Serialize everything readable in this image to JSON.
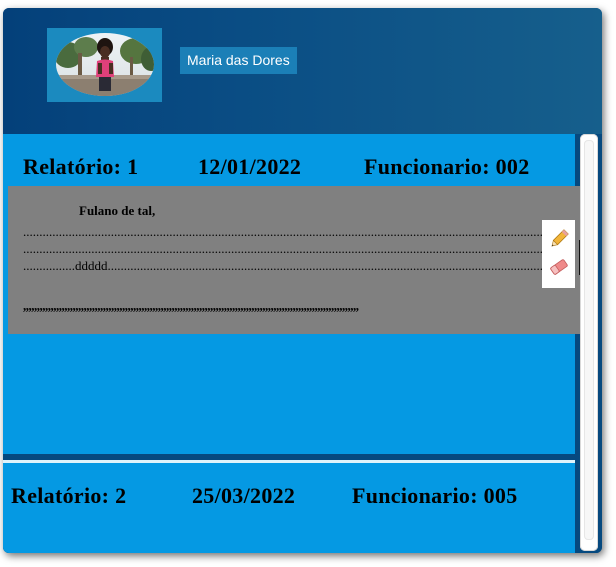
{
  "header": {
    "user_name": "Maria das Dores",
    "avatar_icon": "user-photo"
  },
  "reports": [
    {
      "title": "Relatório: 1",
      "date": "12/01/2022",
      "employee": "Funcionario: 002",
      "greeting": "Fulano de tal,",
      "lines": [
        "....................................................................................................................................................................",
        "....................................................................................................................................................................",
        "................ddddd............................................................................................................................................",
        ",,,,,,,,,,,,,,,,,,,,,,,,,,,,,,,,,,,,,,,,,,,,,,,,,,,,,,,,,,,,,,,,,,,,,,,,,,,,,,,,,,,,,,,,,,,,,,,,,,,,,,,,,,,,,,,,,,,,,,,,,,"
      ]
    },
    {
      "title": "Relatório: 2",
      "date": "25/03/2022",
      "employee": "Funcionario: 005"
    }
  ],
  "tools": {
    "edit_icon": "pencil-icon",
    "delete_icon": "eraser-icon"
  },
  "colors": {
    "header_start": "#04407a",
    "header_end": "#165f8c",
    "card": "#0599e3",
    "report_body": "#808080",
    "name_badge": "#1b7fb7"
  }
}
